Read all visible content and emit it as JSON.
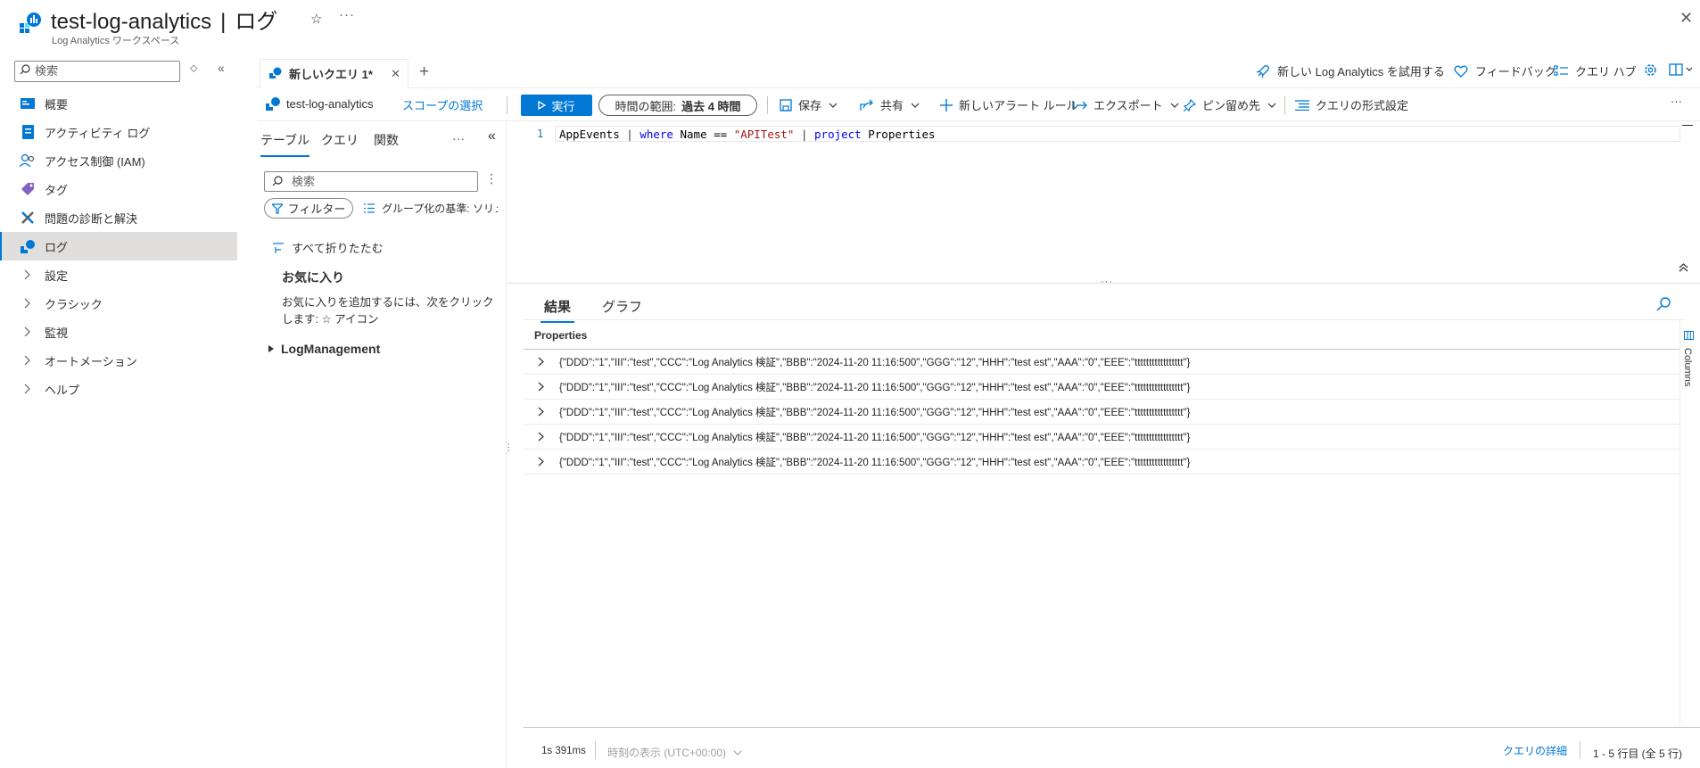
{
  "header": {
    "title": "test-log-analytics",
    "separator": "|",
    "page": "ログ",
    "subtitle": "Log Analytics ワークスペース",
    "more": "···",
    "close": "✕"
  },
  "sidebar": {
    "search_placeholder": "検索",
    "items": [
      {
        "label": "概要",
        "icon": "overview-icon"
      },
      {
        "label": "アクティビティ ログ",
        "icon": "activity-log-icon"
      },
      {
        "label": "アクセス制御 (IAM)",
        "icon": "iam-icon"
      },
      {
        "label": "タグ",
        "icon": "tag-icon"
      },
      {
        "label": "問題の診断と解決",
        "icon": "diagnose-icon"
      },
      {
        "label": "ログ",
        "icon": "logs-icon",
        "active": true
      },
      {
        "label": "設定",
        "icon": "chevron-right-icon"
      },
      {
        "label": "クラシック",
        "icon": "chevron-right-icon"
      },
      {
        "label": "監視",
        "icon": "chevron-right-icon"
      },
      {
        "label": "オートメーション",
        "icon": "chevron-right-icon"
      },
      {
        "label": "ヘルプ",
        "icon": "chevron-right-icon"
      }
    ]
  },
  "tabs": {
    "query_tab": "新しいクエリ 1*",
    "add": "+"
  },
  "top_actions": {
    "try_new": "新しい Log Analytics を試用する",
    "feedback": "フィードバック",
    "query_hub": "クエリ ハブ"
  },
  "command_bar": {
    "scope_name": "test-log-analytics",
    "scope_select": "スコープの選択",
    "run": "実行",
    "time_range_label": "時間の範囲:",
    "time_range_value": "過去 4 時間",
    "save": "保存",
    "share": "共有",
    "new_alert": "新しいアラート ルール",
    "export": "エクスポート",
    "pin": "ピン留め先",
    "format": "クエリの形式設定",
    "more": "···"
  },
  "schema": {
    "tabs": [
      "テーブル",
      "クエリ",
      "関数"
    ],
    "more": "···",
    "search_placeholder": "検索",
    "filter": "フィルター",
    "group_by": "グループ化の基準: ソリュ-",
    "collapse_all": "すべて折りたたむ",
    "favorites_title": "お気に入り",
    "favorites_desc": "お気に入りを追加するには、次をクリックします: ☆ アイコン",
    "tree_item": "LogManagement"
  },
  "editor": {
    "line_number": "1",
    "code": {
      "t1": "AppEvents ",
      "p1": "| ",
      "k1": "where",
      "t2": " Name == ",
      "s1": "\"APITest\"",
      "t3": " ",
      "p2": "| ",
      "k2": "project",
      "t4": " Properties"
    }
  },
  "results": {
    "tabs": [
      "結果",
      "グラフ"
    ],
    "column": "Properties",
    "columns_panel": "Columns",
    "rows": [
      "{\"DDD\":\"1\",\"III\":\"test\",\"CCC\":\"Log Analytics 検証\",\"BBB\":\"2024-11-20 11:16:500\",\"GGG\":\"12\",\"HHH\":\"test est\",\"AAA\":\"0\",\"EEE\":\"ttttttttttttttttt\"}",
      "{\"DDD\":\"1\",\"III\":\"test\",\"CCC\":\"Log Analytics 検証\",\"BBB\":\"2024-11-20 11:16:500\",\"GGG\":\"12\",\"HHH\":\"test est\",\"AAA\":\"0\",\"EEE\":\"ttttttttttttttttt\"}",
      "{\"DDD\":\"1\",\"III\":\"test\",\"CCC\":\"Log Analytics 検証\",\"BBB\":\"2024-11-20 11:16:500\",\"GGG\":\"12\",\"HHH\":\"test est\",\"AAA\":\"0\",\"EEE\":\"ttttttttttttttttt\"}",
      "{\"DDD\":\"1\",\"III\":\"test\",\"CCC\":\"Log Analytics 検証\",\"BBB\":\"2024-11-20 11:16:500\",\"GGG\":\"12\",\"HHH\":\"test est\",\"AAA\":\"0\",\"EEE\":\"ttttttttttttttttt\"}",
      "{\"DDD\":\"1\",\"III\":\"test\",\"CCC\":\"Log Analytics 検証\",\"BBB\":\"2024-11-20 11:16:500\",\"GGG\":\"12\",\"HHH\":\"test est\",\"AAA\":\"0\",\"EEE\":\"ttttttttttttttttt\"}"
    ]
  },
  "status": {
    "exec_time": "1s 391ms",
    "time_display": "時刻の表示 (UTC+00:00)",
    "query_detail": "クエリの詳細",
    "row_count": "1 - 5 行目 (全 5 行)"
  },
  "colors": {
    "accent": "#0078d4",
    "active_nav_bg": "#e1dfdd",
    "keyword": "#0000ff",
    "string": "#a31515"
  }
}
